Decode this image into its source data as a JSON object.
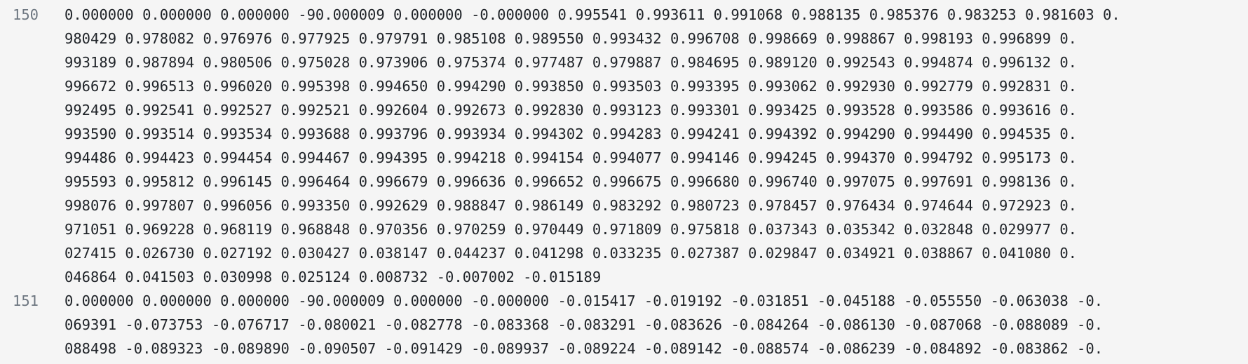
{
  "lines": [
    {
      "number": "150",
      "rows": [
        "0.000000 0.000000 0.000000 -90.000009 0.000000 -0.000000 0.995541 0.993611 0.991068 0.988135 0.985376 0.983253 0.981603 0.",
        "980429 0.978082 0.976976 0.977925 0.979791 0.985108 0.989550 0.993432 0.996708 0.998669 0.998867 0.998193 0.996899 0.",
        "993189 0.987894 0.980506 0.975028 0.973906 0.975374 0.977487 0.979887 0.984695 0.989120 0.992543 0.994874 0.996132 0.",
        "996672 0.996513 0.996020 0.995398 0.994650 0.994290 0.993850 0.993503 0.993395 0.993062 0.992930 0.992779 0.992831 0.",
        "992495 0.992541 0.992527 0.992521 0.992604 0.992673 0.992830 0.993123 0.993301 0.993425 0.993528 0.993586 0.993616 0.",
        "993590 0.993514 0.993534 0.993688 0.993796 0.993934 0.994302 0.994283 0.994241 0.994392 0.994290 0.994490 0.994535 0.",
        "994486 0.994423 0.994454 0.994467 0.994395 0.994218 0.994154 0.994077 0.994146 0.994245 0.994370 0.994792 0.995173 0.",
        "995593 0.995812 0.996145 0.996464 0.996679 0.996636 0.996652 0.996675 0.996680 0.996740 0.997075 0.997691 0.998136 0.",
        "998076 0.997807 0.996056 0.993350 0.992629 0.988847 0.986149 0.983292 0.980723 0.978457 0.976434 0.974644 0.972923 0.",
        "971051 0.969228 0.968119 0.968848 0.970356 0.970259 0.970449 0.971809 0.975818 0.037343 0.035342 0.032848 0.029977 0.",
        "027415 0.026730 0.027192 0.030427 0.038147 0.044237 0.041298 0.033235 0.027387 0.029847 0.034921 0.038867 0.041080 0.",
        "046864 0.041503 0.030998 0.025124 0.008732 -0.007002 -0.015189"
      ]
    },
    {
      "number": "151",
      "rows": [
        "0.000000 0.000000 0.000000 -90.000009 0.000000 -0.000000 -0.015417 -0.019192 -0.031851 -0.045188 -0.055550 -0.063038 -0.",
        "069391 -0.073753 -0.076717 -0.080021 -0.082778 -0.083368 -0.083291 -0.083626 -0.084264 -0.086130 -0.087068 -0.088089 -0.",
        "088498 -0.089323 -0.089890 -0.090507 -0.091429 -0.089937 -0.089224 -0.089142 -0.088574 -0.086239 -0.084892 -0.083862 -0."
      ]
    }
  ]
}
